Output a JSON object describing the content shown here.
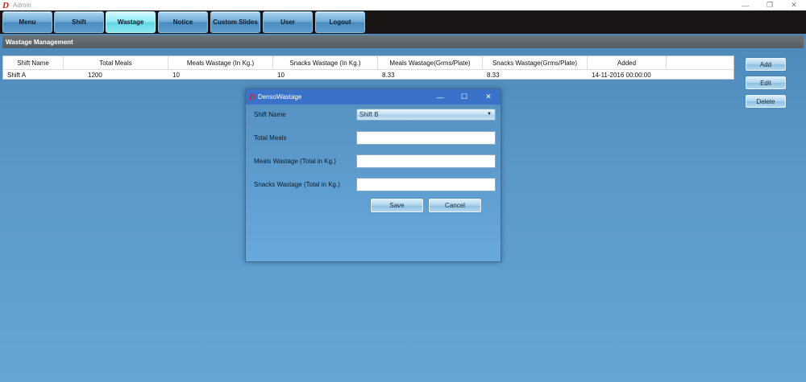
{
  "window": {
    "title": "Admin",
    "app_icon": "D",
    "controls": {
      "minimize": "—",
      "restore": "❐",
      "close": "✕"
    }
  },
  "nav": {
    "tabs": [
      {
        "label": "Menu"
      },
      {
        "label": "Shift"
      },
      {
        "label": "Wastage",
        "active": true
      },
      {
        "label": "Notice"
      },
      {
        "label": "Custom Slides"
      },
      {
        "label": "User"
      },
      {
        "label": "Logout"
      }
    ]
  },
  "section": {
    "title": "Wastage Management"
  },
  "grid": {
    "columns": [
      "Shift Name",
      "Total Meals",
      "Meals Wastage (In Kg.)",
      "Snacks Wastage (In Kg.)",
      "Meals Wastage(Grms/Plate)",
      "Snacks Wastage(Grms/Plate)",
      "Added"
    ],
    "rows": [
      [
        "Shift A",
        "1200",
        "10",
        "10",
        "8.33",
        "8.33",
        "14-11-2016 00:00:00"
      ]
    ]
  },
  "actions": {
    "add": "Add",
    "edit": "Edit",
    "delete": "Delete"
  },
  "dialog": {
    "title": "DensoWastage",
    "icon": "D",
    "controls": {
      "minimize": "—",
      "maximize": "☐",
      "close": "✕"
    },
    "fields": {
      "shift_name_label": "Shift Name",
      "shift_name_value": "Shift B",
      "total_meals_label": "Total Meals",
      "total_meals_value": "",
      "meals_wastage_label": "Meals Wastage (Total in Kg.)",
      "meals_wastage_value": "",
      "snacks_wastage_label": "Snacks Wastage (Total in Kg.)",
      "snacks_wastage_value": ""
    },
    "save": "Save",
    "cancel": "Cancel"
  },
  "colors": {
    "background": "#5a98c8",
    "navbar": "#1a1514",
    "active_tab": "#8fe9f2",
    "section_header": "#5f666b",
    "dialog_titlebar": "#3a72c9"
  }
}
